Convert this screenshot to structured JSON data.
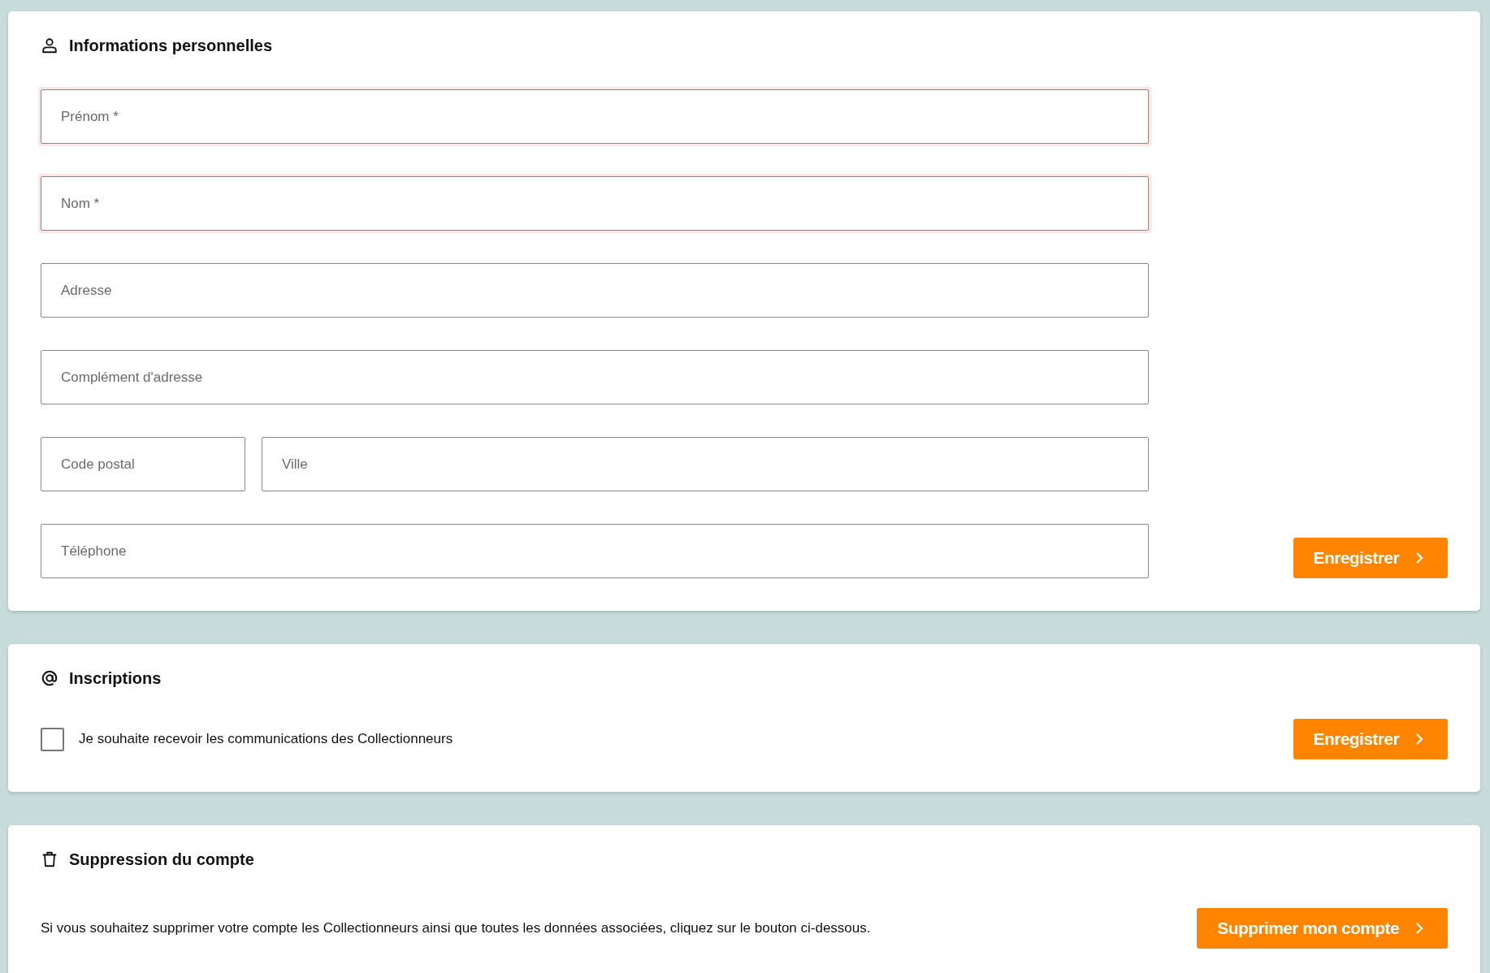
{
  "personal": {
    "title": "Informations personnelles",
    "rows": [
      [
        {
          "placeholder": "Prénom *",
          "invalid": true
        }
      ],
      [
        {
          "placeholder": "Nom *",
          "invalid": true
        }
      ],
      [
        {
          "placeholder": "Adresse",
          "invalid": false
        }
      ],
      [
        {
          "placeholder": "Complément d'adresse",
          "invalid": false
        }
      ],
      [
        {
          "placeholder": "Code postal",
          "invalid": false
        },
        {
          "placeholder": "Ville",
          "invalid": false
        }
      ],
      [
        {
          "placeholder": "Téléphone",
          "invalid": false
        }
      ]
    ],
    "button": "Enregistrer"
  },
  "subscriptions": {
    "title": "Inscriptions",
    "checkbox": {
      "label": "Je souhaite recevoir les communications des Collectionneurs",
      "checked": false
    },
    "button": "Enregistrer"
  },
  "deletion": {
    "title": "Suppression du compte",
    "text": "Si vous souhaitez supprimer votre compte les Collectionneurs ainsi que toutes les données associées, cliquez sur le bouton ci-dessous.",
    "button": "Supprimer mon compte"
  }
}
